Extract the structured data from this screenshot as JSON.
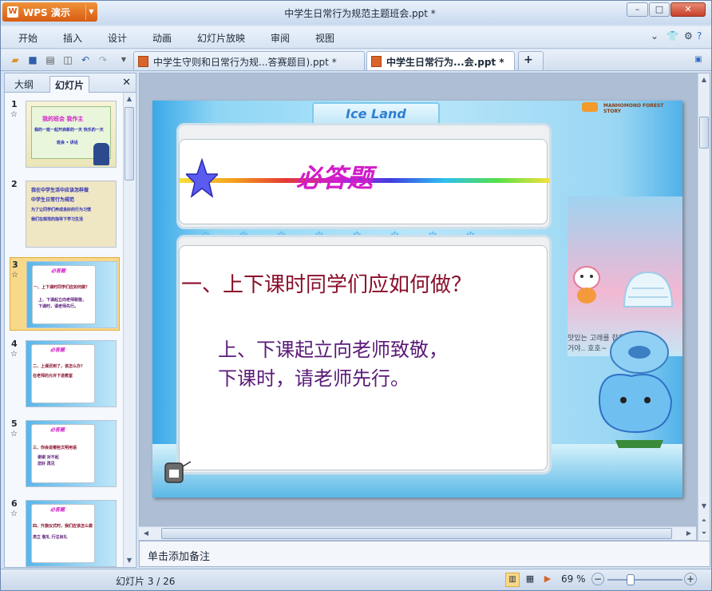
{
  "app": {
    "logo_text": "WPS 演示",
    "window_title": "中学生日常行为规范主题班会.ppt *"
  },
  "window_buttons": {
    "minimize": "–",
    "maximize": "□",
    "close": "✕"
  },
  "menu": {
    "items": [
      "开始",
      "插入",
      "设计",
      "动画",
      "幻灯片放映",
      "审阅",
      "视图"
    ]
  },
  "tabs": [
    {
      "label": "中学生守则和日常行为规...答赛题目).ppt *"
    },
    {
      "label": "中学生日常行为...会.ppt *"
    }
  ],
  "toolbar": {
    "new_tab_label": "+"
  },
  "panel": {
    "tab_outline": "大纲",
    "tab_slides": "幻灯片",
    "close": "✕"
  },
  "thumbnails": [
    {
      "num": "1",
      "lines": [
        "我的班会 我作主",
        "我的一班一起开启新的一天 快乐的一天",
        "班会 • 讲话"
      ]
    },
    {
      "num": "2",
      "lines": [
        "我在中学生活中应该怎样做",
        "中学生日常行为规范",
        "为了让同学们养成良好的行为习惯",
        "我们在规范的指导下学习生活"
      ]
    },
    {
      "num": "3",
      "lines": [
        "必答题",
        "一、上下课时同学们应如何做？",
        "上、下课起立向老师致敬，",
        "下课时，请老师先行。"
      ]
    },
    {
      "num": "4",
      "lines": [
        "必答题",
        "二、上课迟到了，该怎么办？",
        "在老师的允许下进教室"
      ]
    },
    {
      "num": "5",
      "lines": [
        "必答题",
        "三、你会说哪些文明用语",
        "谢谢  对不起",
        "您好  再见"
      ]
    },
    {
      "num": "6",
      "lines": [
        "必答题",
        "四、升旗仪式时，我们应该怎么做",
        "肃立  敬礼  行注目礼"
      ]
    }
  ],
  "slide": {
    "banner": "Ice Land",
    "brand": "MANHOMONO FOREST STORY",
    "heading": "必答题",
    "question": "一、上下课时同学们应如何做？",
    "answer_line1": "上、下课起立向老师致敬，",
    "answer_line2": "下课时，请老师先行。",
    "korean_note": "맛있는 고래를 잡은 거야.. 호호~"
  },
  "notes": {
    "placeholder": "单击添加备注"
  },
  "status": {
    "slide_indicator": "幻灯片 3 / 26",
    "zoom": "69 %"
  }
}
